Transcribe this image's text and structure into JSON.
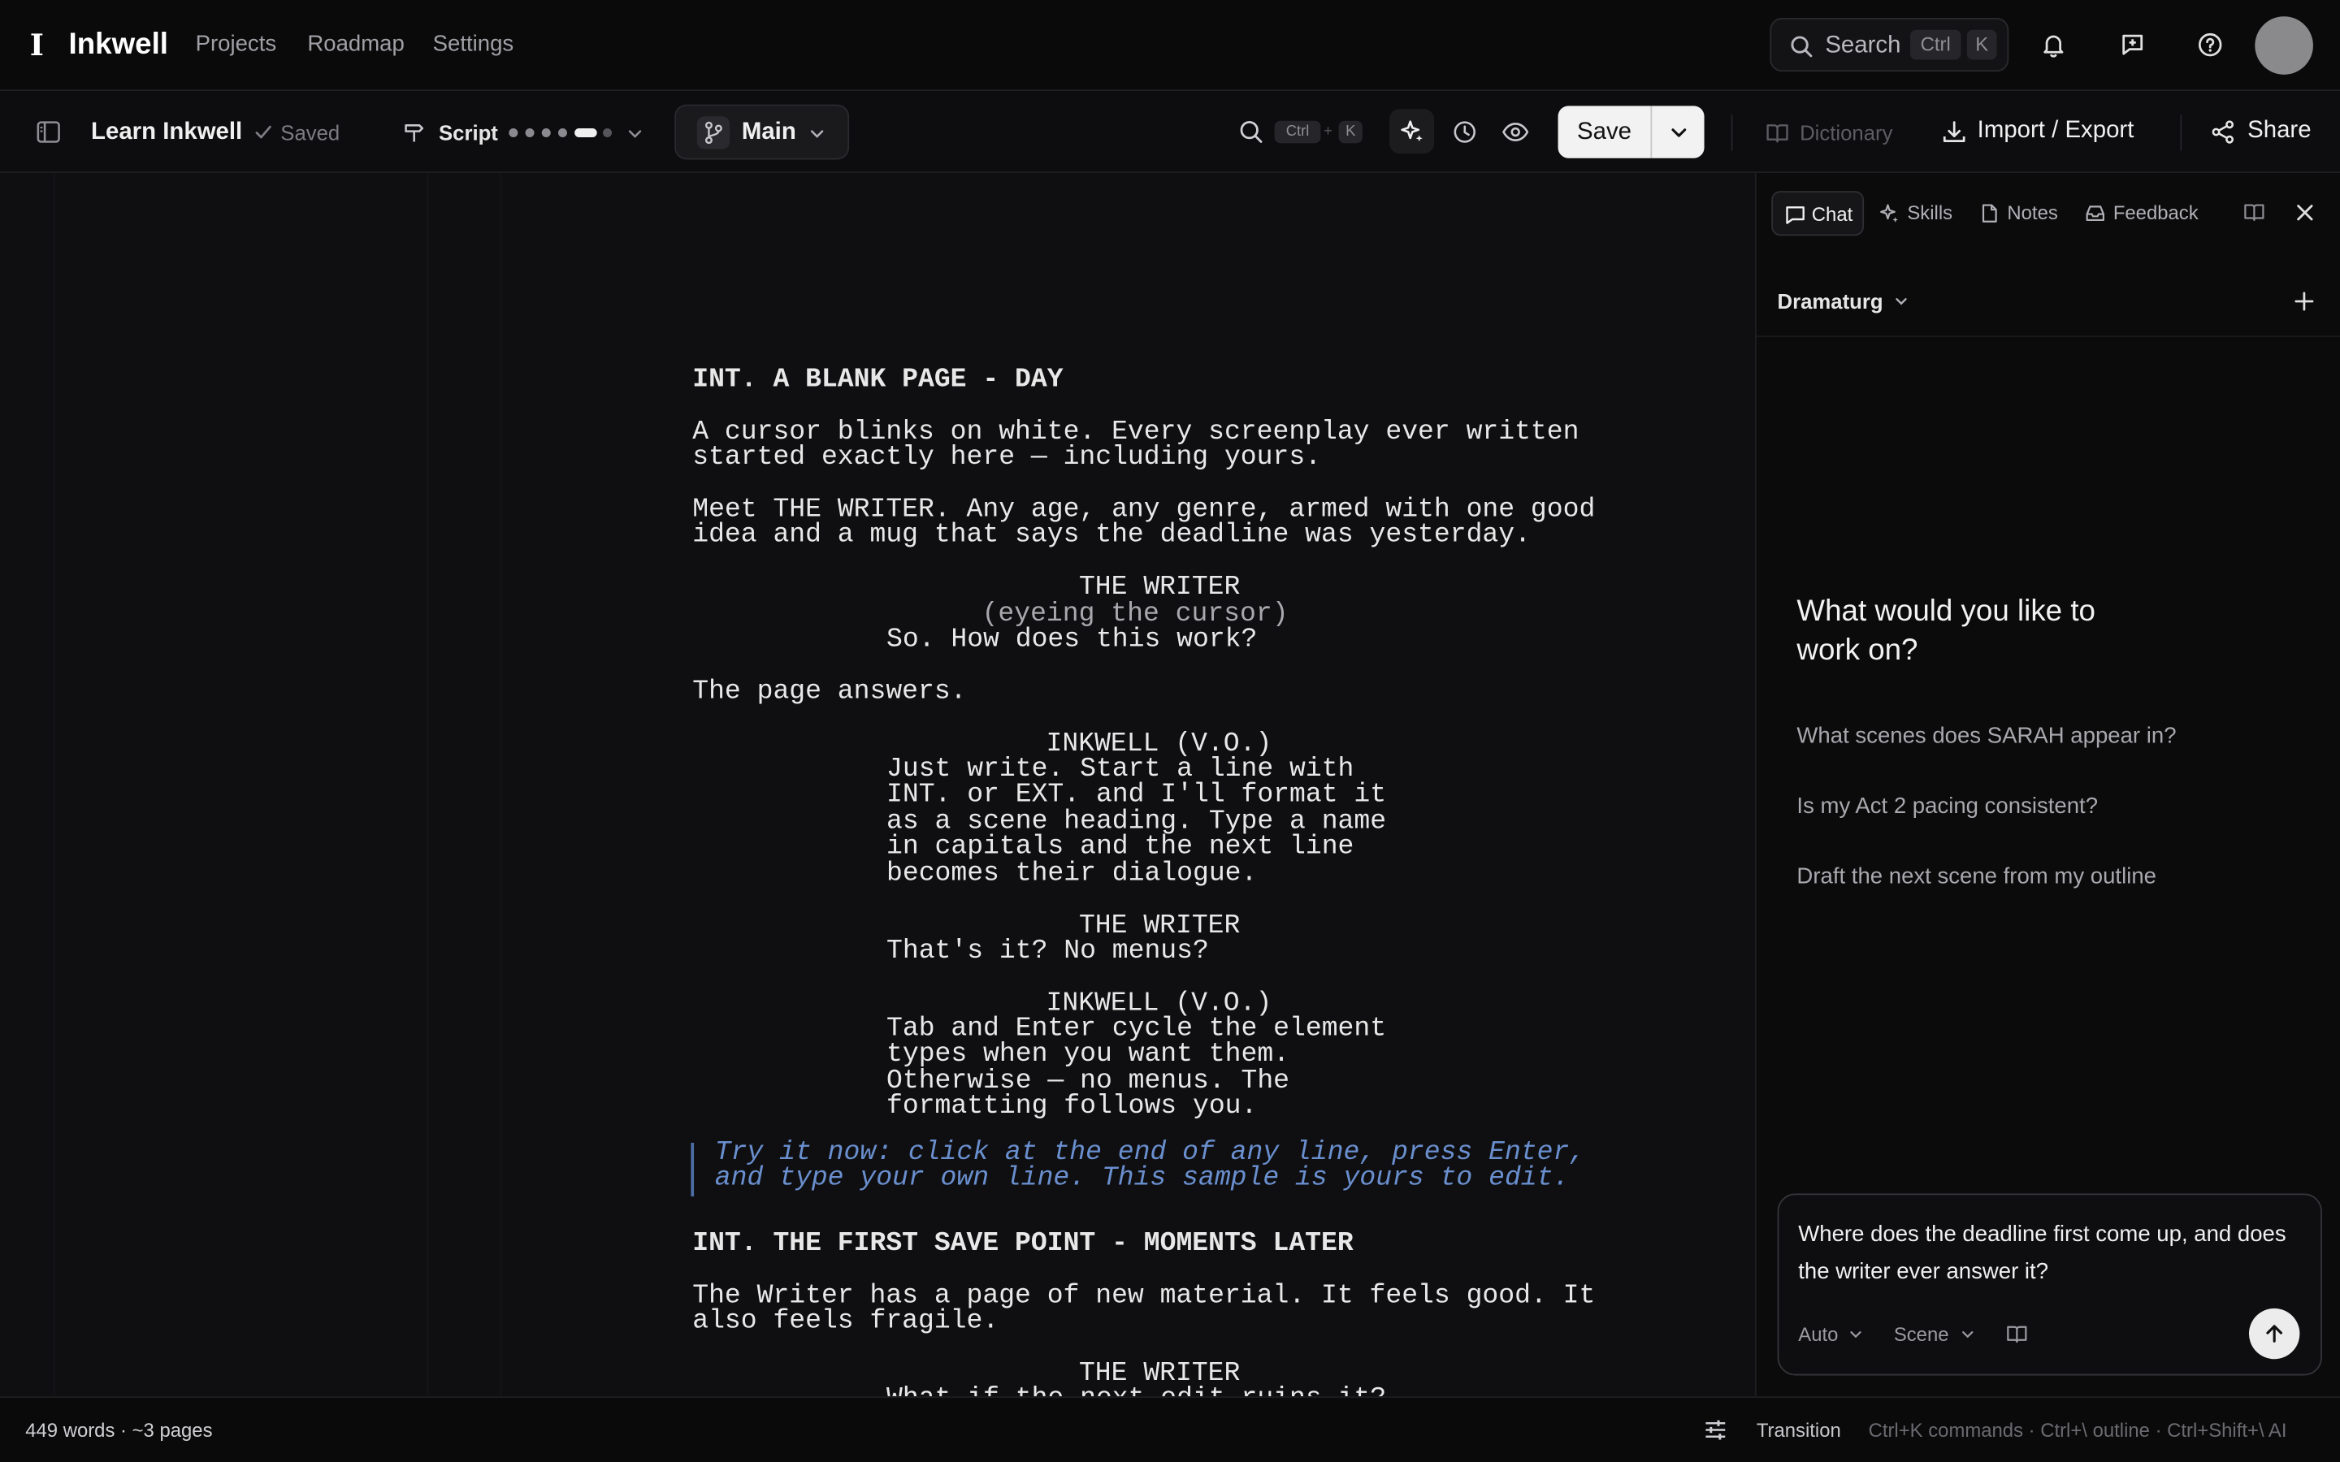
{
  "app": {
    "logo_mark": "I",
    "name": "Inkwell",
    "nav": [
      "Projects",
      "Roadmap",
      "Settings"
    ]
  },
  "topbar": {
    "search_label": "Search",
    "search_kbd": [
      "Ctrl",
      "K"
    ],
    "icons": [
      "bell-icon",
      "message-icon",
      "help-icon"
    ]
  },
  "toolbar": {
    "doc_title": "Learn Inkwell",
    "saved_label": "Saved",
    "script_label": "Script",
    "branch_label": "Main",
    "find_kbd": [
      "Ctrl",
      "+",
      "K"
    ],
    "save_label": "Save",
    "dictionary_label": "Dictionary",
    "import_export_label": "Import / Export",
    "share_label": "Share"
  },
  "script": {
    "lines": [
      {
        "type": "heading",
        "text": "INT. A BLANK PAGE - DAY"
      },
      {
        "type": "action",
        "text": "A cursor blinks on white. Every screenplay ever written\nstarted exactly here — including yours."
      },
      {
        "type": "action",
        "text": "Meet THE WRITER. Any age, any genre, armed with one good\nidea and a mug that says the deadline was yesterday."
      },
      {
        "type": "character",
        "text": "THE WRITER"
      },
      {
        "type": "parenthetical",
        "text": "(eyeing the cursor)"
      },
      {
        "type": "dialogue",
        "text": "So. How does this work?"
      },
      {
        "type": "action",
        "text": "The page answers."
      },
      {
        "type": "character",
        "text": "INKWELL (V.O.)"
      },
      {
        "type": "dialogue",
        "text": "Just write. Start a line with\nINT. or EXT. and I'll format it\nas a scene heading. Type a name\nin capitals and the next line\nbecomes their dialogue."
      },
      {
        "type": "character",
        "text": "THE WRITER"
      },
      {
        "type": "dialogue",
        "text": "That's it? No menus?"
      },
      {
        "type": "character",
        "text": "INKWELL (V.O.)"
      },
      {
        "type": "dialogue",
        "text": "Tab and Enter cycle the element\ntypes when you want them.\nOtherwise — no menus. The\nformatting follows you."
      },
      {
        "type": "hint",
        "text": "Try it now: click at the end of any line, press Enter,\nand type your own line. This sample is yours to edit."
      },
      {
        "type": "heading",
        "text": "INT. THE FIRST SAVE POINT - MOMENTS LATER"
      },
      {
        "type": "action",
        "text": "The Writer has a page of new material. It feels good. It\nalso feels fragile."
      },
      {
        "type": "character",
        "text": "THE WRITER"
      },
      {
        "type": "dialogue",
        "text": "What if the next edit ruins it?"
      }
    ]
  },
  "panel": {
    "tabs": [
      "Chat",
      "Skills",
      "Notes",
      "Feedback"
    ],
    "agent": "Dramaturg",
    "heading": "What would you like to work on?",
    "suggestions": [
      "What scenes does SARAH appear in?",
      "Is my Act 2 pacing consistent?",
      "Draft the next scene from my outline"
    ],
    "composer_text": "Where does the deadline first come up, and does the writer ever answer it?",
    "mode": "Auto",
    "scope": "Scene"
  },
  "status": {
    "word_count": "449 words · ~3 pages",
    "element_type": "Transition",
    "shortcuts": "Ctrl+K commands · Ctrl+\\ outline · Ctrl+Shift+\\ AI"
  }
}
